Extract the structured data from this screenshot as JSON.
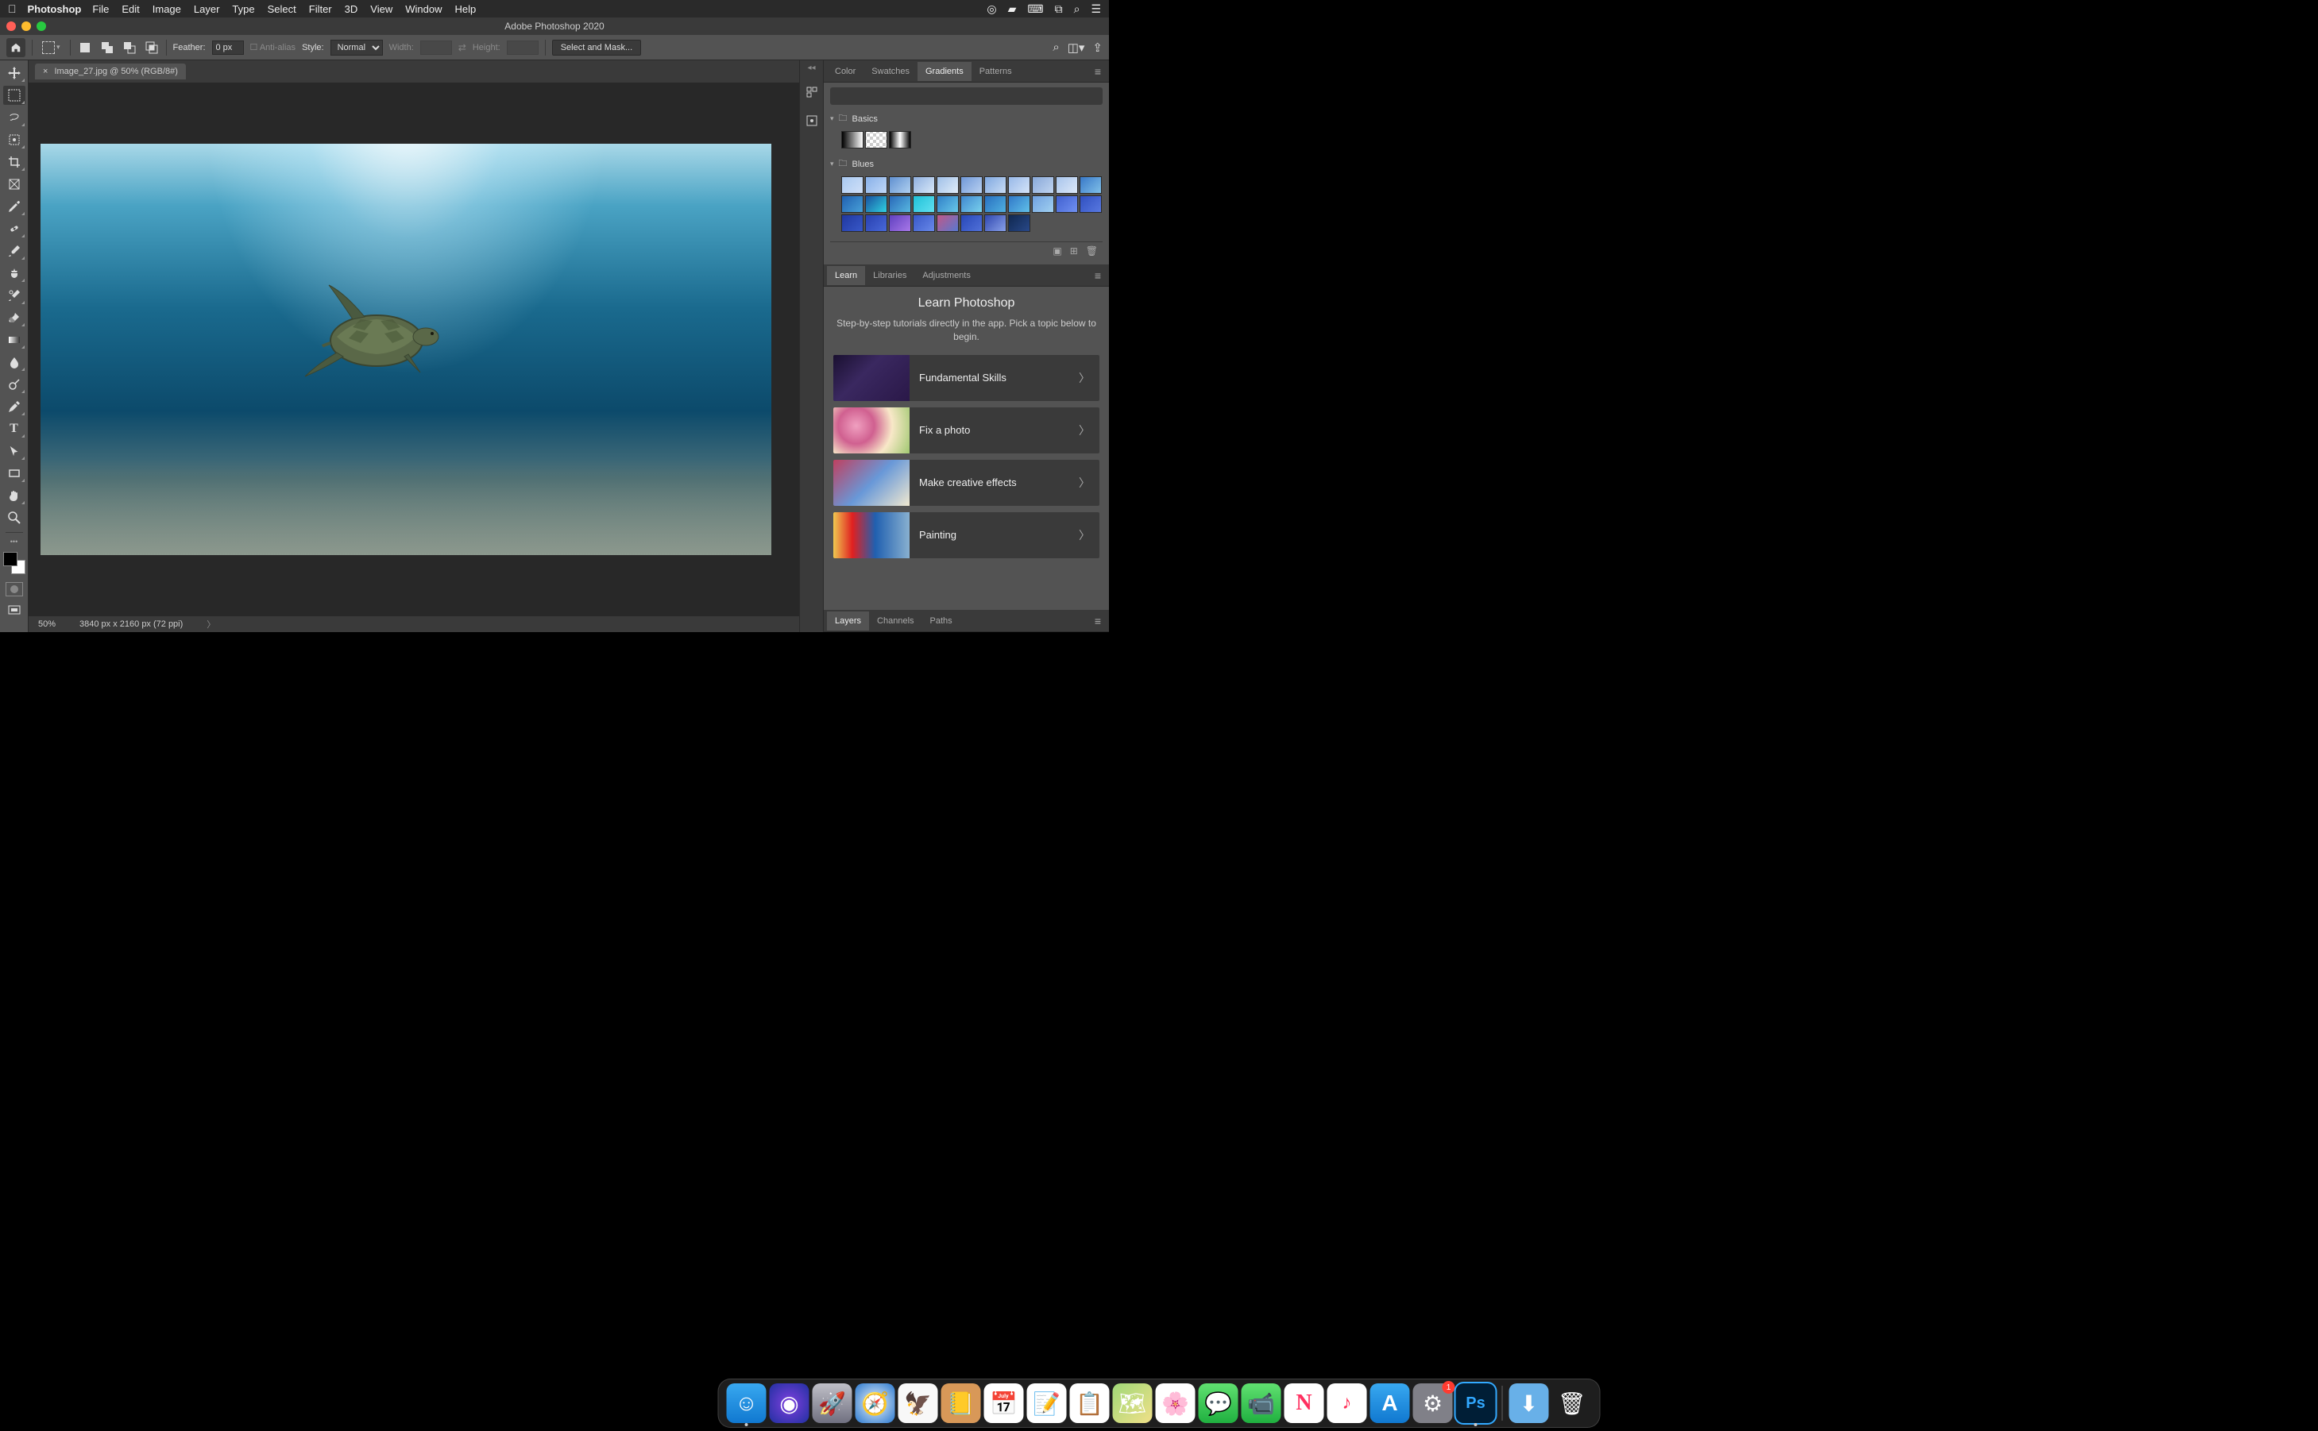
{
  "macmenu": {
    "app": "Photoshop",
    "items": [
      "File",
      "Edit",
      "Image",
      "Layer",
      "Type",
      "Select",
      "Filter",
      "3D",
      "View",
      "Window",
      "Help"
    ]
  },
  "window": {
    "title": "Adobe Photoshop 2020"
  },
  "options": {
    "feather_label": "Feather:",
    "feather_value": "0 px",
    "antialias_label": "Anti-alias",
    "style_label": "Style:",
    "style_value": "Normal",
    "width_label": "Width:",
    "height_label": "Height:",
    "select_mask_label": "Select and Mask..."
  },
  "document": {
    "tab_label": "Image_27.jpg @ 50% (RGB/8#)",
    "status_zoom": "50%",
    "status_dims": "3840 px x 2160 px (72 ppi)"
  },
  "panels": {
    "top_tabs": [
      "Color",
      "Swatches",
      "Gradients",
      "Patterns"
    ],
    "top_active": "Gradients",
    "gradients": {
      "folders": [
        {
          "name": "Basics",
          "swatches": [
            "linear-gradient(90deg,#000,#fff)",
            "repeating-conic-gradient(#ccc 0 25%, #fff 0 50%) 50% / 8px 8px",
            "linear-gradient(90deg,#000,#fff,#000)"
          ]
        },
        {
          "name": "Blues",
          "swatches": [
            "linear-gradient(135deg,#a8c8f0,#d0e0f8)",
            "linear-gradient(135deg,#88b0e8,#c0d8f8)",
            "linear-gradient(135deg,#6090d0,#b0d0f0)",
            "linear-gradient(135deg,#90b0e0,#d8e8f8)",
            "linear-gradient(135deg,#a0c0e8,#e0ecf8)",
            "linear-gradient(135deg,#7098d8,#b8d0f0)",
            "linear-gradient(135deg,#80a8e0,#c8dcf4)",
            "linear-gradient(135deg,#98b8e8,#d4e4f8)",
            "linear-gradient(135deg,#88a8d8,#c0d4f0)",
            "linear-gradient(135deg,#a8c4ec,#dce8f8)",
            "linear-gradient(135deg,#3878c8,#80c0e8)",
            "linear-gradient(135deg,#2060b0,#48a0d8)",
            "linear-gradient(135deg,#1850a0,#30d0e0)",
            "linear-gradient(135deg,#2868b8,#58b8e0)",
            "linear-gradient(135deg,#20c0d8,#60e0f0)",
            "linear-gradient(135deg,#3080c8,#68c8e8)",
            "linear-gradient(135deg,#4088d0,#78d0ec)",
            "linear-gradient(135deg,#2870c0,#50b0e0)",
            "linear-gradient(135deg,#3078c8,#60c0e8)",
            "linear-gradient(135deg,#70a0e0,#a0d0f0)",
            "linear-gradient(135deg,#4060d0,#7090f0)",
            "linear-gradient(135deg,#3050c0,#5878e0)",
            "linear-gradient(135deg,#2038a0,#3858c8)",
            "linear-gradient(135deg,#2840b0,#4868d8)",
            "linear-gradient(135deg,#6040c0,#a878e8)",
            "linear-gradient(135deg,#3858c8,#6888e8)",
            "linear-gradient(135deg,#c05888,#5878d0)",
            "linear-gradient(135deg,#2848b8,#5070d8)",
            "linear-gradient(135deg,#3048b0,#88a0e8)",
            "linear-gradient(135deg,#102850,#284888)"
          ]
        }
      ]
    },
    "mid_tabs": [
      "Learn",
      "Libraries",
      "Adjustments"
    ],
    "mid_active": "Learn",
    "learn": {
      "title": "Learn Photoshop",
      "subtitle": "Step-by-step tutorials directly in the app. Pick a topic below to begin.",
      "items": [
        {
          "label": "Fundamental Skills",
          "thumb": "linear-gradient(135deg,#1a1030,#3a2860 40%,#2a1848)"
        },
        {
          "label": "Fix a photo",
          "thumb": "radial-gradient(circle at 30% 40%,#f0a0c0,#d06090 30%,#f8e8c8 60%,#a0c870)"
        },
        {
          "label": "Make creative effects",
          "thumb": "linear-gradient(135deg,#c04060,#6898d8 50%,#f0e8d0)"
        },
        {
          "label": "Painting",
          "thumb": "linear-gradient(90deg,#f0c850 0%,#e02020 25%,#2060b0 55%,#88b0d0 100%)"
        }
      ]
    },
    "bottom_tabs": [
      "Layers",
      "Channels",
      "Paths"
    ],
    "bottom_active": "Layers"
  },
  "dock": {
    "apps": [
      {
        "name": "finder",
        "bg": "linear-gradient(180deg,#38a8f0,#1078d0)",
        "glyph": "☺",
        "running": true
      },
      {
        "name": "siri",
        "bg": "radial-gradient(circle,#8040e0,#2030a0)",
        "glyph": "◉"
      },
      {
        "name": "launchpad",
        "bg": "linear-gradient(180deg,#c0c0c8,#707080)",
        "glyph": "🚀"
      },
      {
        "name": "safari",
        "bg": "radial-gradient(circle,#f0f4f8,#2878d0)",
        "glyph": "🧭"
      },
      {
        "name": "mail",
        "bg": "#f8f8f8",
        "glyph": "🦅"
      },
      {
        "name": "contacts",
        "bg": "#d89858",
        "glyph": "📒"
      },
      {
        "name": "calendar",
        "bg": "#fff",
        "glyph": "📅"
      },
      {
        "name": "notes",
        "bg": "#fff",
        "glyph": "📝"
      },
      {
        "name": "reminders",
        "bg": "#fff",
        "glyph": "📋"
      },
      {
        "name": "maps",
        "bg": "linear-gradient(135deg,#a0d878,#f0e088)",
        "glyph": "🗺"
      },
      {
        "name": "photos",
        "bg": "#fff",
        "glyph": "🌸"
      },
      {
        "name": "messages",
        "bg": "linear-gradient(180deg,#60e070,#20b040)",
        "glyph": "💬"
      },
      {
        "name": "facetime",
        "bg": "linear-gradient(180deg,#60e070,#20b040)",
        "glyph": "📹"
      },
      {
        "name": "news",
        "bg": "#fff",
        "glyph": "N"
      },
      {
        "name": "music",
        "bg": "#fff",
        "glyph": "♪"
      },
      {
        "name": "appstore",
        "bg": "linear-gradient(180deg,#38a8f0,#1078d0)",
        "glyph": "A"
      },
      {
        "name": "preferences",
        "bg": "#808088",
        "glyph": "⚙",
        "badge": "1"
      },
      {
        "name": "photoshop",
        "bg": "#001e36",
        "glyph": "Ps",
        "running": true,
        "active": true
      },
      {
        "name": "downloads",
        "bg": "#68b0e8",
        "glyph": "⬇",
        "separator_before": true
      },
      {
        "name": "trash",
        "bg": "transparent",
        "glyph": "🗑"
      }
    ]
  }
}
